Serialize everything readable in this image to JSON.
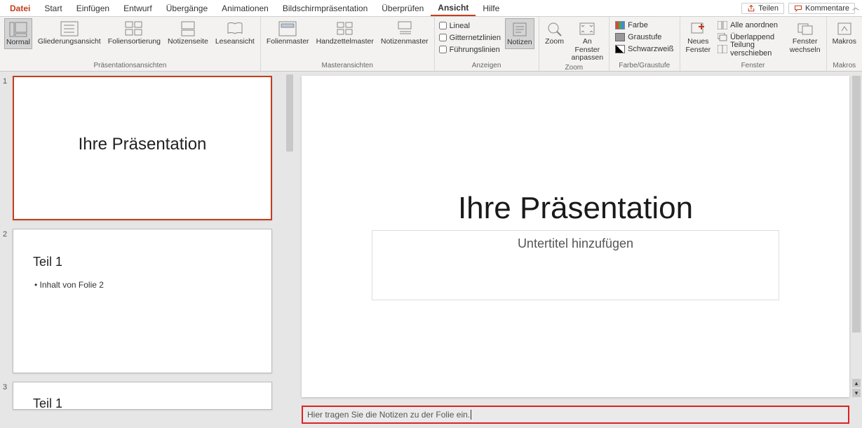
{
  "menubar": {
    "tabs": [
      "Datei",
      "Start",
      "Einfügen",
      "Entwurf",
      "Übergänge",
      "Animationen",
      "Bildschirmpräsentation",
      "Überprüfen",
      "Ansicht",
      "Hilfe"
    ],
    "active_index": 8,
    "share_label": "Teilen",
    "comments_label": "Kommentare"
  },
  "ribbon": {
    "groups": {
      "presentation_views": {
        "label": "Präsentationsansichten",
        "normal": "Normal",
        "outline": "Gliederungsansicht",
        "sorter": "Foliensortierung",
        "notes_page": "Notizenseite",
        "reading": "Leseansicht"
      },
      "master_views": {
        "label": "Masteransichten",
        "slide_master": "Folienmaster",
        "handout_master": "Handzettelmaster",
        "notes_master": "Notizenmaster"
      },
      "show": {
        "label": "Anzeigen",
        "ruler": "Lineal",
        "gridlines": "Gitternetzlinien",
        "guides": "Führungslinien",
        "notes_btn": "Notizen"
      },
      "zoom": {
        "label": "Zoom",
        "zoom_btn": "Zoom",
        "fit_btn": "An Fenster\nanpassen"
      },
      "color_gray": {
        "label": "Farbe/Graustufe",
        "color": "Farbe",
        "gray": "Graustufe",
        "bw": "Schwarzweiß"
      },
      "window": {
        "label": "Fenster",
        "new_window": "Neues\nFenster",
        "arrange_all": "Alle anordnen",
        "cascade": "Überlappend",
        "move_split": "Teilung verschieben",
        "switch": "Fenster\nwechseln"
      },
      "macros": {
        "label": "Makros",
        "macros_btn": "Makros"
      }
    }
  },
  "thumbnails": [
    {
      "num": "1",
      "title": "Ihre Präsentation",
      "selected": true
    },
    {
      "num": "2",
      "title": "Teil 1",
      "body": "• Inhalt von Folie 2",
      "selected": false
    },
    {
      "num": "3",
      "title": "Teil 1",
      "selected": false
    }
  ],
  "slide": {
    "title": "Ihre Präsentation",
    "subtitle_placeholder": "Untertitel hinzufügen"
  },
  "notes": {
    "placeholder": "Hier tragen Sie die Notizen zu der Folie ein."
  }
}
